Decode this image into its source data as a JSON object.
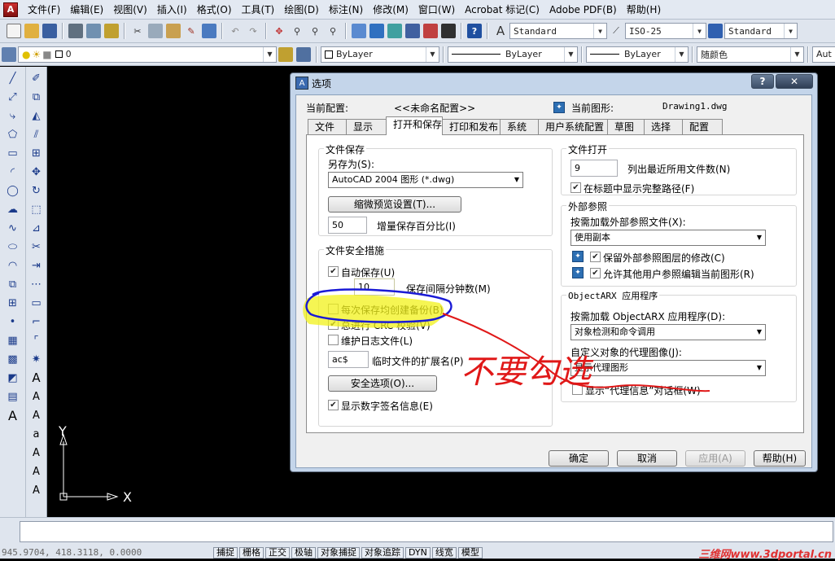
{
  "app": {
    "icon_name": "autocad-app-icon"
  },
  "menu": [
    "文件(F)",
    "编辑(E)",
    "视图(V)",
    "插入(I)",
    "格式(O)",
    "工具(T)",
    "绘图(D)",
    "标注(N)",
    "修改(M)",
    "窗口(W)",
    "Acrobat 标记(C)",
    "Adobe PDF(B)",
    "帮助(H)"
  ],
  "toolbar": {
    "text_style": "Standard",
    "dim_style": "ISO-25",
    "table_style": "Standard",
    "layer": "0",
    "color": "ByLayer",
    "linetype": "ByLayer",
    "lineweight": "ByLayer",
    "plotstyle": "随颜色",
    "extra": "Aut"
  },
  "canvas": {
    "axis_y": "Y",
    "axis_x": "X"
  },
  "status": {
    "coords": "945.9704, 418.3118, 0.0000",
    "buttons": [
      "捕捉",
      "栅格",
      "正交",
      "极轴",
      "对象捕捉",
      "对象追踪",
      "DYN",
      "线宽",
      "模型"
    ]
  },
  "watermark": "三维网www.3dportal.cn",
  "dialog": {
    "title": "选项",
    "help_label": "?",
    "close_label": "✕",
    "current_profile_label": "当前配置:",
    "current_profile_value": "<<未命名配置>>",
    "current_drawing_label": "当前图形:",
    "current_drawing_value": "Drawing1.dwg",
    "tabs": [
      "文件",
      "显示",
      "打开和保存",
      "打印和发布",
      "系统",
      "用户系统配置",
      "草图",
      "选择",
      "配置"
    ],
    "active_tab": "打开和保存",
    "file_save": {
      "title": "文件保存",
      "save_as_label": "另存为(S):",
      "save_as_value": "AutoCAD 2004 图形 (*.dwg)",
      "thumbnail_button": "缩微预览设置(T)...",
      "incremental_value": "50",
      "incremental_label": "增量保存百分比(I)"
    },
    "safety": {
      "title": "文件安全措施",
      "autosave_label": "自动保存(U)",
      "autosave_checked": true,
      "minutes_value": "10",
      "minutes_label": "保存间隔分钟数(M)",
      "backup_label": "每次保存均创建备份(B)",
      "backup_checked": false,
      "crc_label": "总进行 CRC 校验(V)",
      "crc_checked": true,
      "log_label": "维护日志文件(L)",
      "log_checked": false,
      "ext_value": "ac$",
      "ext_label": "临时文件的扩展名(P)",
      "security_button": "安全选项(O)...",
      "digital_sig_label": "显示数字签名信息(E)",
      "digital_sig_checked": true
    },
    "file_open": {
      "title": "文件打开",
      "recent_value": "9",
      "recent_label": "列出最近所用文件数(N)",
      "fullpath_label": "在标题中显示完整路径(F)",
      "fullpath_checked": true
    },
    "xref": {
      "title": "外部参照",
      "demand_label": "按需加载外部参照文件(X):",
      "demand_value": "使用副本",
      "retain_label": "保留外部参照图层的修改(C)",
      "retain_checked": true,
      "allow_label": "允许其他用户参照编辑当前图形(R)",
      "allow_checked": true
    },
    "arx": {
      "title": "ObjectARX 应用程序",
      "load_label": "按需加载 ObjectARX 应用程序(D):",
      "load_value": "对象检测和命令调用",
      "proxy_label": "自定义对象的代理图像(J):",
      "proxy_value": "显示代理图形",
      "proxy_dialog_label": "显示“代理信息”对话框(W)",
      "proxy_dialog_checked": false
    },
    "buttons": {
      "ok": "确定",
      "cancel": "取消",
      "apply": "应用(A)",
      "help": "帮助(H)"
    }
  },
  "annotation": {
    "text": "不要勾选",
    "colors": {
      "highlight": "#f2f21a",
      "circle": "#1a1ad6",
      "ink": "#e01818"
    }
  }
}
